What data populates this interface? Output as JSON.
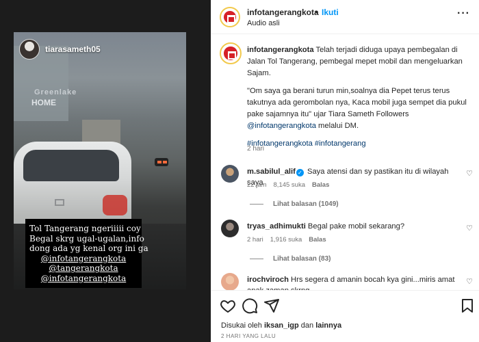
{
  "story": {
    "username": "tiarasameth05",
    "building_sign_1": "Greenlake",
    "building_sign_2": "HOME",
    "caption_lines": [
      "Tol Tangerang ngeriiiii coy",
      "Begal skrg ugal-ugalan,info",
      "dong ada yg kenal org ini ga",
      "@infotangerangkota",
      "@tangerangkota",
      "@infotangerangkota"
    ]
  },
  "header": {
    "username": "infotangerangkota",
    "dot": "•",
    "follow_label": "Ikuti",
    "audio_label": "Audio asli",
    "more_label": "···"
  },
  "caption": {
    "username": "infotangerangkota",
    "paragraph1": " Telah terjadi diduga upaya pembegalan di Jalan Tol Tangerang, pembegal mepet mobil dan mengeluarkan Sajam.",
    "paragraph2_before": "\"Om saya ga berani turun min,soalnya dia Pepet terus terus takutnya ada gerombolan nya, Kaca mobil juga sempet dia pukul pake sajamnya itu\" ujar Tiara Sameth Followers ",
    "paragraph2_mention": "@infotangerangkota",
    "paragraph2_after": " melalui DM.",
    "hashtags": "#infotangerangkota #infotangerang",
    "time": "2 hari"
  },
  "comments": [
    {
      "username": "m.sabilul_alif",
      "verified": true,
      "text": " Saya atensi dan sy pastikan itu di wilayah saya",
      "time": "22 jam",
      "likes": "8,145 suka",
      "reply": "Balas",
      "view_replies": "Lihat balasan (1049)"
    },
    {
      "username": "tryas_adhimukti",
      "verified": false,
      "text": " Begal pake mobil sekarang?",
      "time": "2 hari",
      "likes": "1,916 suka",
      "reply": "Balas",
      "view_replies": "Lihat balasan (83)"
    },
    {
      "username": "irochviroch",
      "verified": false,
      "text": " Hrs segera d amanin bocah kya gini...miris amat anak zaman skrng",
      "time": "",
      "likes": "",
      "reply": ""
    }
  ],
  "footer": {
    "liked_prefix": "Disukai oleh ",
    "liked_user": "iksan_igp",
    "liked_mid": " dan ",
    "liked_suffix": "lainnya",
    "posted": "2 HARI YANG LALU"
  },
  "icons": [
    "heart-icon",
    "comment-icon",
    "share-icon",
    "bookmark-icon",
    "more-icon",
    "verified-icon"
  ],
  "colors": {
    "accent": "#0095f6",
    "mention": "#00376b",
    "muted": "#737373",
    "logo_red": "#d62027",
    "logo_gold": "#f2c94c"
  }
}
